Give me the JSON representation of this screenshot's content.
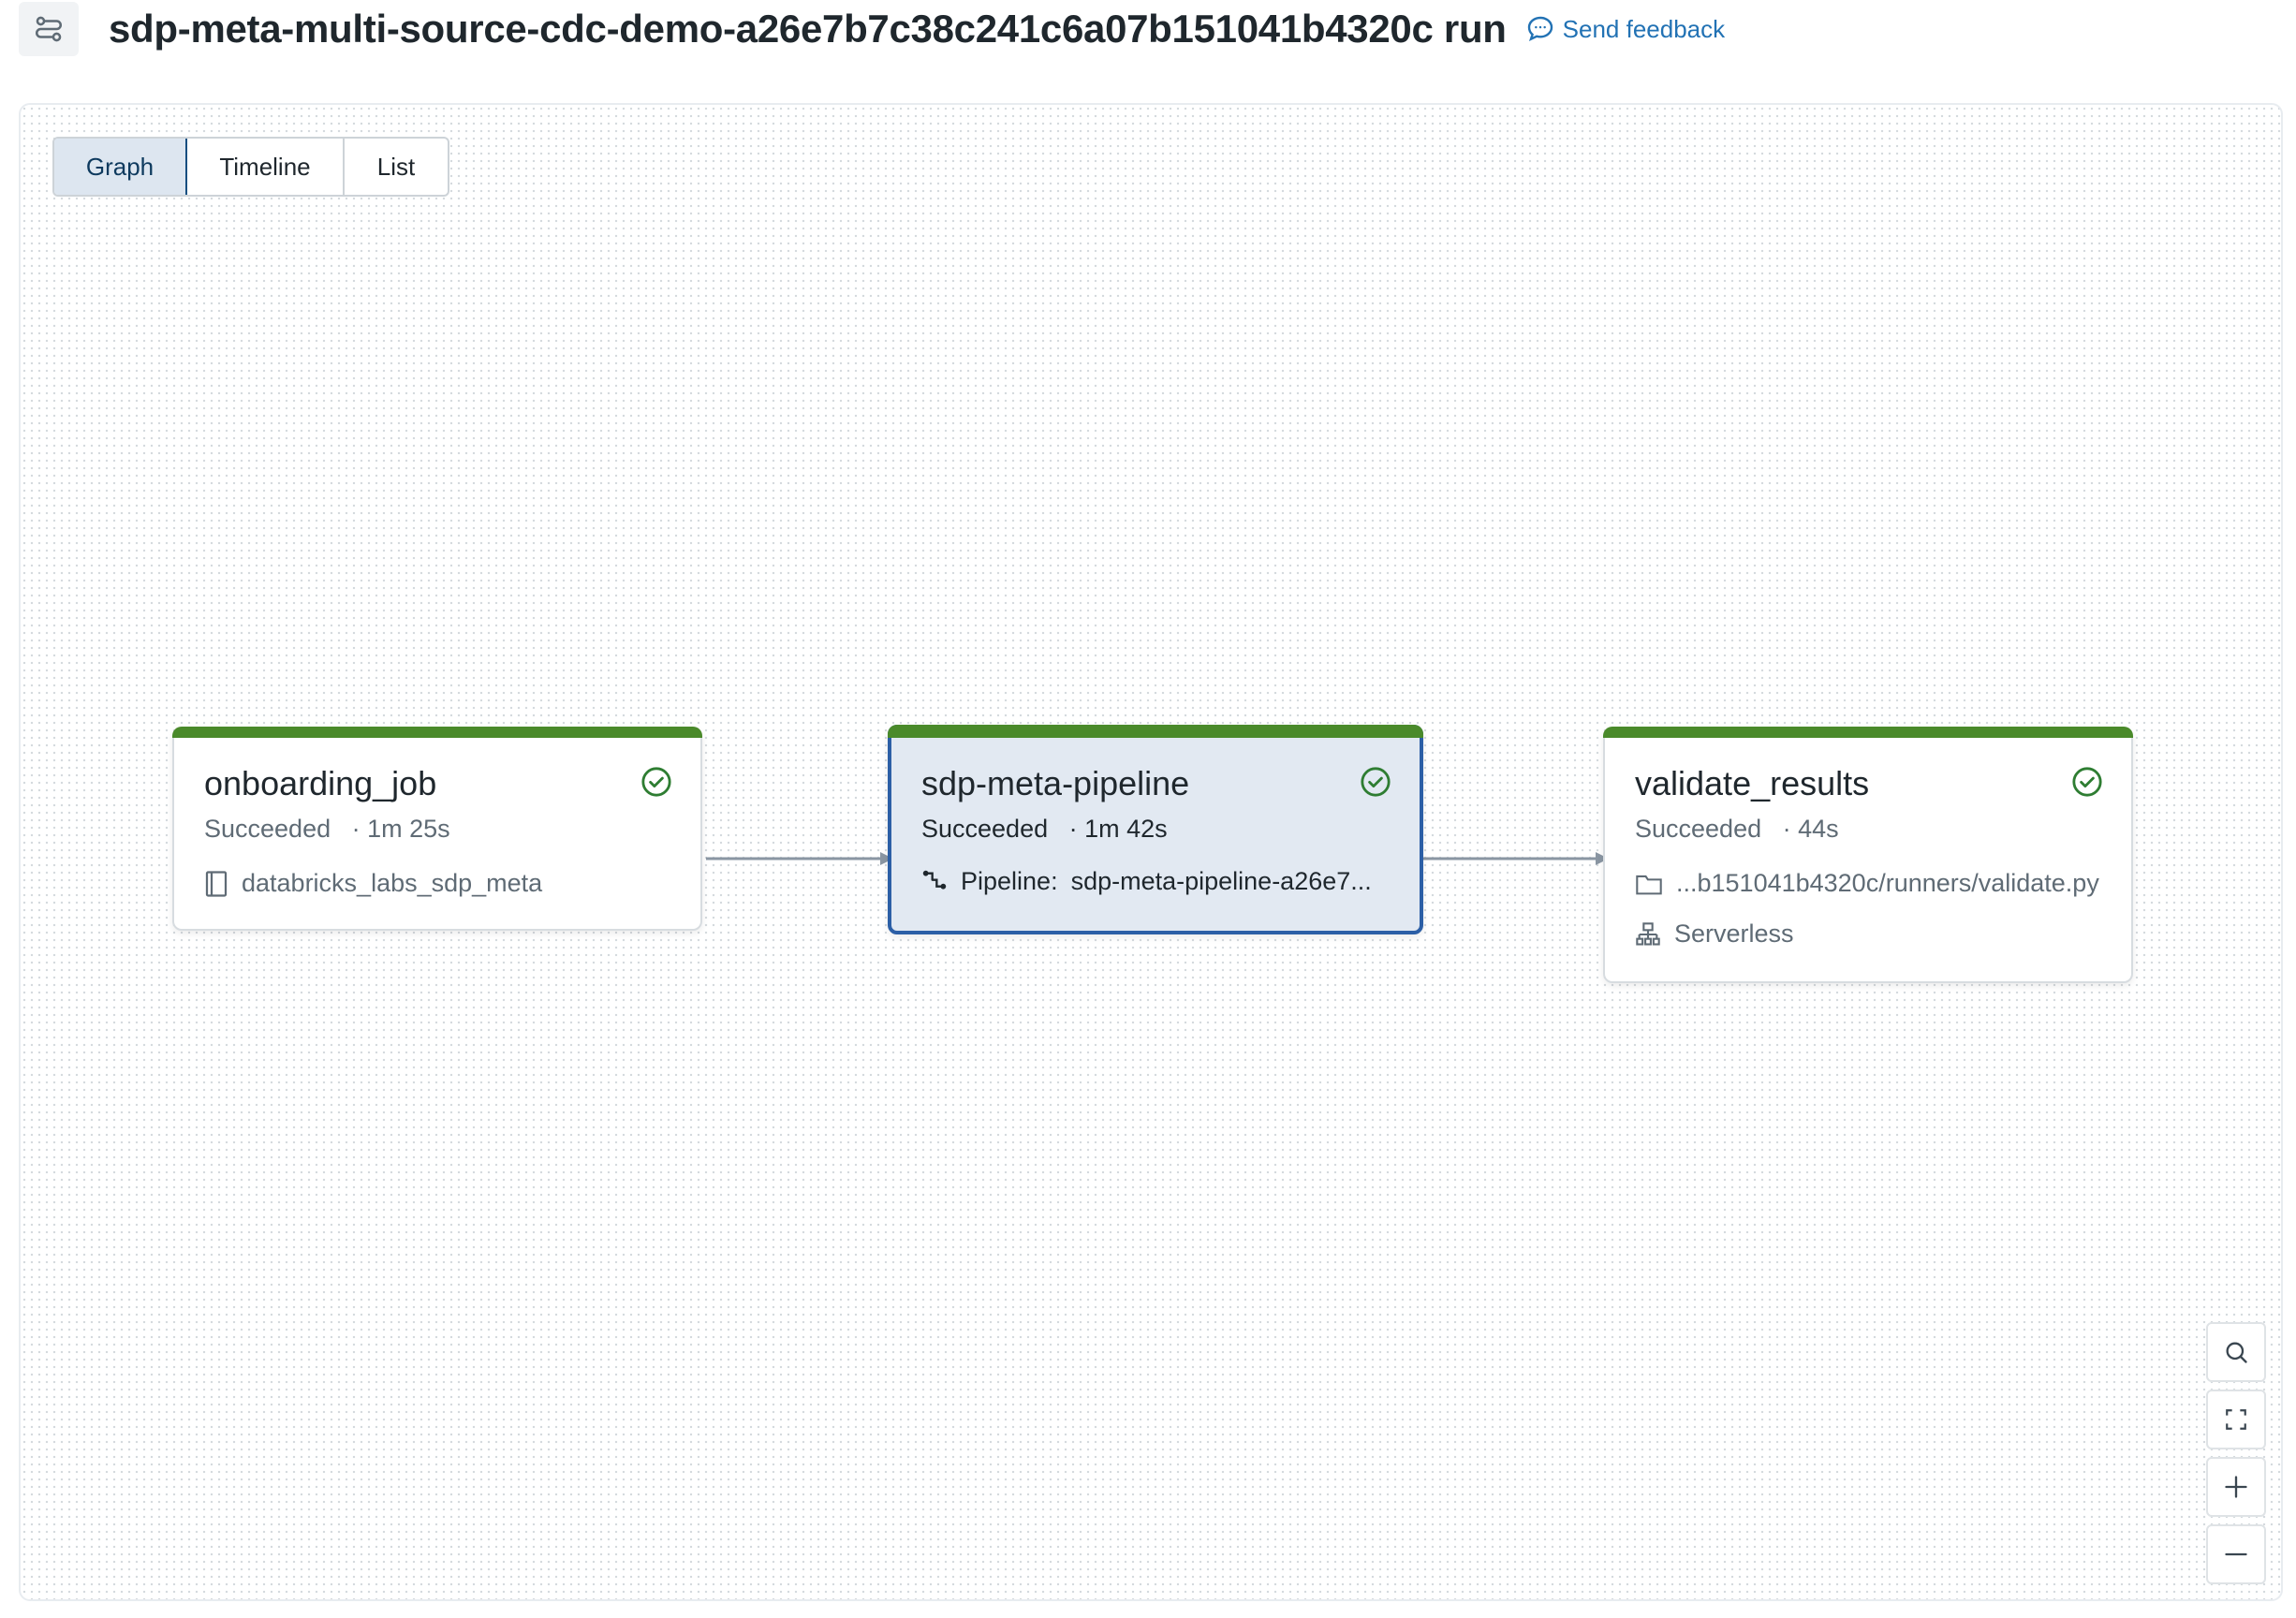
{
  "header": {
    "title": "sdp-meta-multi-source-cdc-demo-a26e7b7c38c241c6a07b151041b4320c run",
    "feedback_label": "Send feedback"
  },
  "view_tabs": [
    {
      "label": "Graph",
      "active": true
    },
    {
      "label": "Timeline",
      "active": false
    },
    {
      "label": "List",
      "active": false
    }
  ],
  "tasks": [
    {
      "name": "onboarding_job",
      "status": "Succeeded",
      "duration": "· 1m 25s",
      "detail": "databricks_labs_sdp_meta",
      "detail_icon": "notebook-icon"
    },
    {
      "name": "sdp-meta-pipeline",
      "status": "Succeeded",
      "duration": "· 1m 42s",
      "detail_label": "Pipeline:",
      "detail": "sdp-meta-pipeline-a26e7...",
      "detail_icon": "pipeline-icon",
      "selected": true
    },
    {
      "name": "validate_results",
      "status": "Succeeded",
      "duration": "· 44s",
      "detail": "...b151041b4320c/runners/validate.py",
      "detail_icon": "folder-icon",
      "compute": "Serverless",
      "compute_icon": "cluster-icon"
    }
  ],
  "colors": {
    "success": "#4a8a2a",
    "accent": "#2c5fa6",
    "link": "#2272b4"
  },
  "controls": [
    "search-icon",
    "fit-view-icon",
    "zoom-in-icon",
    "zoom-out-icon"
  ]
}
